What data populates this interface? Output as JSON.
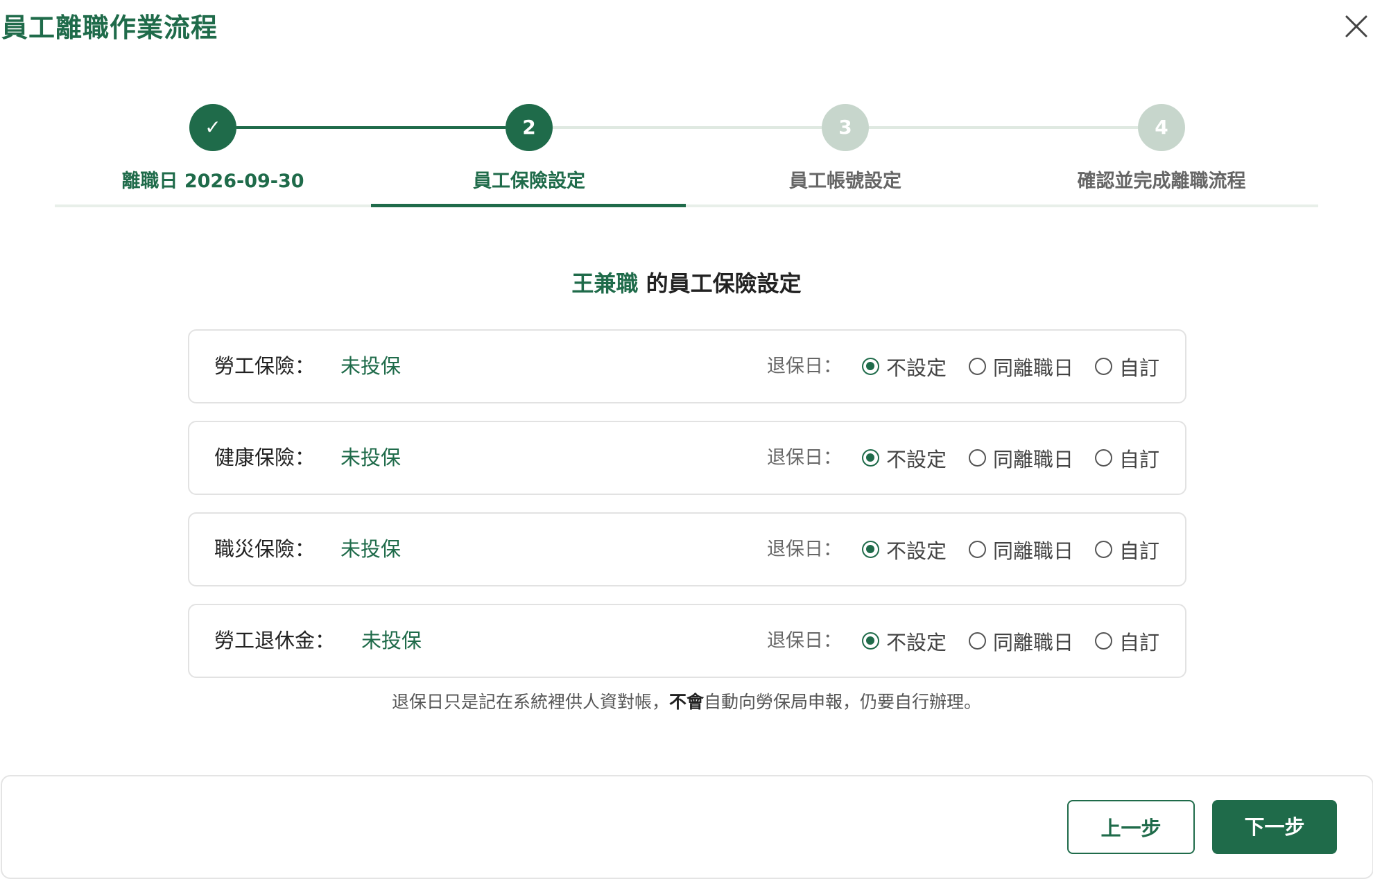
{
  "modal": {
    "title": "員工離職作業流程",
    "close_icon": "close-icon"
  },
  "stepper": {
    "steps": [
      {
        "marker": "✓",
        "label": "離職日 2026-09-30",
        "state": "done"
      },
      {
        "marker": "2",
        "label": "員工保險設定",
        "state": "active"
      },
      {
        "marker": "3",
        "label": "員工帳號設定",
        "state": "pending"
      },
      {
        "marker": "4",
        "label": "確認並完成離職流程",
        "state": "pending"
      }
    ]
  },
  "heading": {
    "employee_name": "王兼職",
    "suffix": " 的員工保險設定"
  },
  "insurance": {
    "quit_date_label": "退保日：",
    "options": [
      "不設定",
      "同離職日",
      "自訂"
    ],
    "rows": [
      {
        "label": "勞工保險：",
        "status": "未投保",
        "selected": "不設定"
      },
      {
        "label": "健康保險：",
        "status": "未投保",
        "selected": "不設定"
      },
      {
        "label": "職災保險：",
        "status": "未投保",
        "selected": "不設定"
      },
      {
        "label": "勞工退休金：",
        "status": "未投保",
        "selected": "不設定"
      }
    ]
  },
  "note": {
    "before": "退保日只是記在系統裡供人資對帳，",
    "bold": "不會",
    "after": "自動向勞保局申報，仍要自行辦理。"
  },
  "footer": {
    "prev_label": "上一步",
    "next_label": "下一步"
  },
  "colors": {
    "primary": "#1f6b4a",
    "pending_step": "#c7d6cc",
    "track_done": "#1f6b4a",
    "track_pending": "#dfe9e1"
  }
}
